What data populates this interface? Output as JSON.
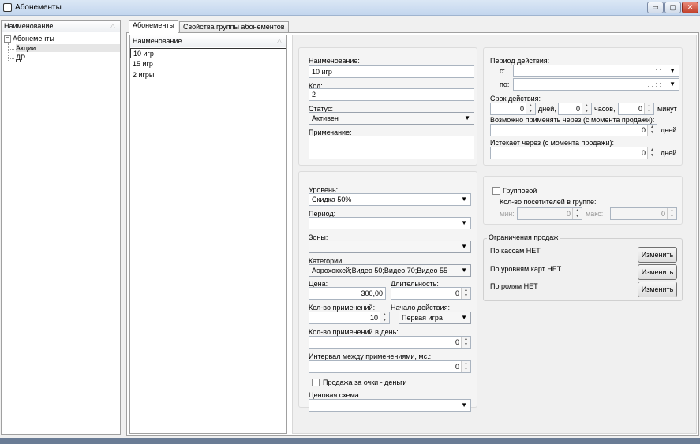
{
  "window": {
    "title": "Абонементы",
    "minimize": "▭",
    "maximize": "▢",
    "close": "✕"
  },
  "tree": {
    "column_header": "Наименование",
    "root": {
      "expander": "−",
      "label": "Абонементы"
    },
    "children": [
      "Акции",
      "ДР"
    ]
  },
  "tabs": [
    {
      "label": "Абонементы",
      "active": true
    },
    {
      "label": "Свойства группы абонементов",
      "active": false
    }
  ],
  "list": {
    "column_header": "Наименование",
    "rows": [
      "10 игр",
      "15 игр",
      "2 игры"
    ]
  },
  "form": {
    "name_label": "Наименование:",
    "name_value": "10 игр",
    "code_label": "Код:",
    "code_value": "2",
    "status_label": "Статус:",
    "status_value": "Активен",
    "note_label": "Примечание:",
    "note_value": "",
    "period": {
      "label": "Период действия:",
      "from_label": "с:",
      "from_value": ". .    : :",
      "to_label": "по:",
      "to_value": ". .    : :"
    },
    "duration": {
      "label": "Срок действия:",
      "days_value": "0",
      "days_unit": "дней,",
      "hours_value": "0",
      "hours_unit": "часов,",
      "minutes_value": "0",
      "minutes_unit": "минут"
    },
    "apply_after": {
      "label": "Возможно применять через (с момента продажи):",
      "value": "0",
      "unit": "дней"
    },
    "expires_after": {
      "label": "Истекает через (с момента продажи):",
      "value": "0",
      "unit": "дней"
    },
    "level_label": "Уровень:",
    "level_value": "Скидка 50%",
    "period2_label": "Период:",
    "period2_value": "",
    "zones_label": "Зоны:",
    "zones_value": "",
    "categories_label": "Категории:",
    "categories_value": "Аэрохоккей;Видео 50;Видео 70;Видео 55",
    "price_label": "Цена:",
    "price_value": "300,00",
    "length_label": "Длительность:",
    "length_value": "0",
    "uses_label": "Кол-во применений:",
    "uses_value": "10",
    "start_label": "Начало действия:",
    "start_value": "Первая игра",
    "uses_per_day_label": "Кол-во применений в день:",
    "uses_per_day_value": "0",
    "interval_label": "Интервал между применениями, мс.:",
    "interval_value": "0",
    "points_sale_label": "Продажа за очки - деньги",
    "price_scheme_label": "Ценовая схема:",
    "price_scheme_value": "",
    "group": {
      "checkbox_label": "Групповой",
      "count_label": "Кол-во посетителей в группе:",
      "min_label": "мин:",
      "min_value": "0",
      "max_label": "макс:",
      "max_value": "0"
    },
    "restrictions": {
      "title": "Ограничения продаж",
      "by_cash": "По кассам НЕТ",
      "by_card_levels": "По уровням карт НЕТ",
      "by_roles": "По ролям НЕТ",
      "change_button": "Изменить"
    }
  }
}
